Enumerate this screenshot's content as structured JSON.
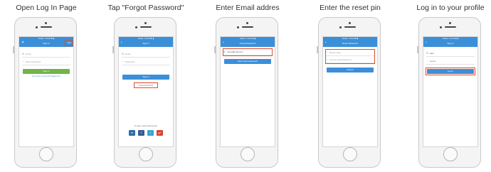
{
  "steps": [
    {
      "caption": "Open Log In Page",
      "screen": {
        "status": "Carrier ✦ 9:41 AM ▮",
        "nav_title": "Sign In",
        "nav_left": "✕",
        "nav_right": "Join",
        "email_placeholder": "Email",
        "password_placeholder": "Enter Password",
        "signin_label": "Sign In",
        "register_prompt": "Do not have an account? Register here"
      }
    },
    {
      "caption": "Tap \"Forgot Password\"",
      "screen": {
        "status": "Carrier ✦ 9:41 AM ▮",
        "nav_title": "Sign In",
        "nav_left": "‹",
        "email_placeholder": "Email",
        "password_placeholder": "Password",
        "signin_label": "Sign In",
        "forgot_label": "Forgot Password?",
        "social_prompt": "Or sign in with social account",
        "social": [
          "in",
          "f",
          "t",
          "g+"
        ]
      }
    },
    {
      "caption": "Enter Email addres",
      "screen": {
        "status": "Carrier ✦ 9:41 AM ▮",
        "nav_title": "Forgot Password",
        "nav_left": "‹",
        "email_value": "name@mail.com",
        "send_label": "Send reset password"
      }
    },
    {
      "caption": "Enter the reset pin",
      "screen": {
        "status": "Carrier ✦ 9:41 AM ▮",
        "nav_title": "Reset Password",
        "nav_left": "‹",
        "pin_placeholder": "Reset Code",
        "new_password_placeholder": "Choose new Password",
        "submit_label": "Submit"
      }
    },
    {
      "caption": "Log in to your profile",
      "screen": {
        "status": "Carrier ✦ 9:41 AM ▮",
        "nav_title": "Sign In",
        "nav_left": "‹",
        "email_value": "user",
        "password_value": "••••••••",
        "login_label": "Log In"
      }
    }
  ],
  "colors": {
    "accent": "#3a8fd8",
    "green": "#71b44a",
    "highlight": "#e24b2b",
    "linkedin": "#2a6ea8",
    "facebook": "#3b5998",
    "twitter": "#3aa3d9",
    "google": "#d9432f"
  },
  "icons": {
    "email": "envelope-icon",
    "password": "lock-icon",
    "back": "chevron-left-icon",
    "close": "close-icon"
  }
}
